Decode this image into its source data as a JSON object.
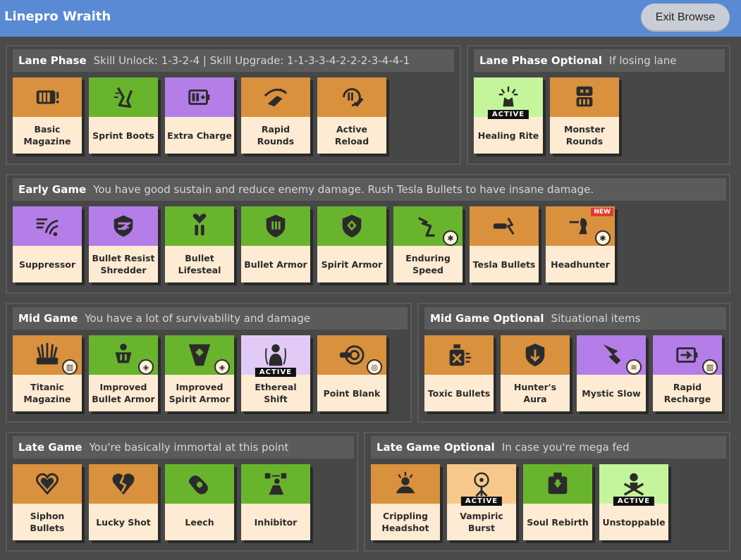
{
  "app": {
    "title": "Linepro Wraith",
    "exit_label": "Exit Browse"
  },
  "labels": {
    "active": "ACTIVE",
    "new": "NEW"
  },
  "sections": {
    "lane": {
      "title": "Lane Phase",
      "subtitle": "Skill Unlock: 1-3-2-4 | Skill Upgrade: 1-1-3-3-4-2-2-2-3-4-4-1",
      "items": [
        "Basic Magazine",
        "Sprint Boots",
        "Extra Charge",
        "Rapid Rounds",
        "Active Reload"
      ]
    },
    "lane_opt": {
      "title": "Lane Phase Optional",
      "subtitle": "If losing lane",
      "items": [
        "Healing Rite",
        "Monster Rounds"
      ]
    },
    "early": {
      "title": "Early Game",
      "subtitle": "You have good sustain and reduce enemy damage. Rush Tesla Bullets to have insane damage.",
      "items": [
        "Suppressor",
        "Bullet Resist Shredder",
        "Bullet Lifesteal",
        "Bullet Armor",
        "Spirit Armor",
        "Enduring Speed",
        "Tesla Bullets",
        "Headhunter"
      ]
    },
    "mid": {
      "title": "Mid Game",
      "subtitle": "You have a lot of survivability and damage",
      "items": [
        "Titanic Magazine",
        "Improved Bullet Armor",
        "Improved Spirit Armor",
        "Ethereal Shift",
        "Point Blank"
      ]
    },
    "mid_opt": {
      "title": "Mid Game Optional",
      "subtitle": "Situational items",
      "items": [
        "Toxic Bullets",
        "Hunter's Aura",
        "Mystic Slow",
        "Rapid Recharge"
      ]
    },
    "late": {
      "title": "Late Game",
      "subtitle": "You're basically immortal at this point",
      "items": [
        "Siphon Bullets",
        "Lucky Shot",
        "Leech",
        "Inhibitor"
      ]
    },
    "late_opt": {
      "title": "Late Game Optional",
      "subtitle": "In case you're mega fed",
      "items": [
        "Crippling Headshot",
        "Vampiric Burst",
        "Soul Rebirth",
        "Unstoppable"
      ]
    }
  },
  "colors": {
    "topbar": "#5a8ad3",
    "weapon": "#d9913d",
    "vitality": "#69b42d",
    "spirit": "#b57de8",
    "card_label_bg": "#fdebd3",
    "new_badge": "#e23a2c"
  }
}
